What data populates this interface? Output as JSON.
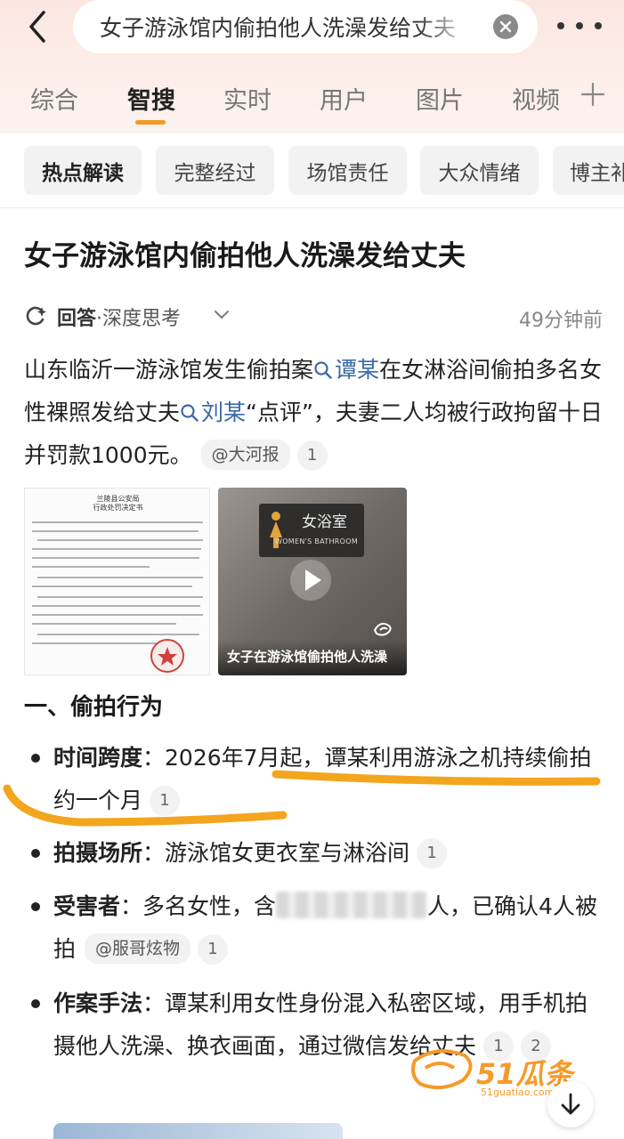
{
  "header": {
    "search_query": "女子游泳馆内偷拍他人洗澡发给丈夫"
  },
  "tabs": [
    "综合",
    "智搜",
    "实时",
    "用户",
    "图片",
    "视频"
  ],
  "chips": [
    "热点解读",
    "完整经过",
    "场馆责任",
    "大众情绪",
    "博主补"
  ],
  "article": {
    "title": "女子游泳馆内偷拍他人洗澡发给丈夫",
    "meta_answer": "回答",
    "meta_mode": "·深度思考",
    "meta_time": "49分钟前",
    "para_1": "山东临沂一游泳馆发生偷拍案",
    "link_1": "谭某",
    "para_2": "在女淋浴间偷拍多名女性裸照发给丈夫",
    "link_2": "刘某",
    "para_3": "“点评”，夫妻二人均被行政拘留十日并罚款1000元。",
    "source_1": "@大河报",
    "ref_1": "1"
  },
  "images": {
    "doc_title": "兰陵县公安局",
    "doc_subtitle": "行政处罚决定书",
    "sign_cn": "女浴室",
    "sign_en": "WOMEN'S BATHROOM",
    "video_caption": "女子在游泳馆偷拍他人洗澡"
  },
  "section": {
    "heading": "一、偷拍行为",
    "bullets": [
      {
        "label": "时间跨度",
        "sep": "：",
        "text": "2026年7月起，谭某利用游泳之机持续偷拍约一个月",
        "refs": [
          "1"
        ]
      },
      {
        "label": "拍摄场所",
        "sep": "：",
        "text": "游泳馆女更衣室与淋浴间",
        "refs": [
          "1"
        ]
      },
      {
        "label": "受害者",
        "sep": "：",
        "text_a": "多名女性，含",
        "text_b": "人，已确认4人被拍",
        "source": "@服哥炫物",
        "refs": [
          "1"
        ]
      },
      {
        "label": "作案手法",
        "sep": "：",
        "text": "谭某利用女性身份混入私密区域，用手机拍摄他人洗澡、换衣画面，通过微信发给丈夫",
        "refs": [
          "1",
          "2"
        ]
      }
    ]
  },
  "watermark": {
    "brand": "51瓜条",
    "url": "51guatiao.com"
  },
  "colors": {
    "accent": "#f29a24",
    "link": "#3b6aa8",
    "header_bg": "#fbe6e0"
  }
}
